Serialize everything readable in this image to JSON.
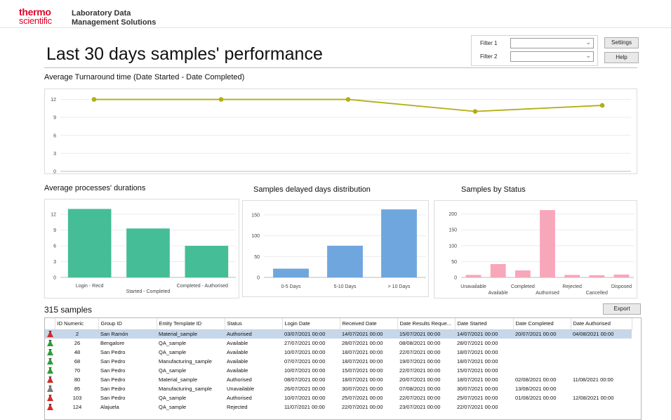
{
  "header": {
    "logo_top": "thermo",
    "logo_bottom": "scientific",
    "app_line1": "Laboratory Data",
    "app_line2": "Management Solutions"
  },
  "page_title": "Last 30 days samples' performance",
  "filters": {
    "filter1_label": "Filter 1",
    "filter2_label": "Filter 2",
    "filter1_value": "",
    "filter2_value": ""
  },
  "buttons": {
    "settings": "Settings",
    "help": "Help",
    "export": "Export"
  },
  "sections": {
    "turnaround": "Average Turnaround time (Date Started - Date Completed)",
    "durations": "Average processes' durations",
    "delayed": "Samples delayed days distribution",
    "status": "Samples by Status"
  },
  "colors": {
    "line": "#b1ae12",
    "green": "#45bd97",
    "blue": "#6fa6dd",
    "pink": "#f8a6ba",
    "selected_row": "#c6d7ea"
  },
  "chart_data": [
    {
      "id": "turnaround",
      "type": "line",
      "title": "Average Turnaround time (Date Started - Date Completed)",
      "x": [
        1,
        2,
        3,
        4,
        5
      ],
      "values": [
        12,
        12,
        12,
        10,
        11
      ],
      "yticks": [
        "0",
        "3",
        "6",
        "9",
        "12"
      ],
      "ylim": [
        0,
        13
      ],
      "grid": true
    },
    {
      "id": "durations",
      "type": "bar",
      "title": "Average processes' durations",
      "categories": [
        "Login - Recd",
        "Started - Completed",
        "Completed - Authorised"
      ],
      "values": [
        13,
        9.3,
        6
      ],
      "yticks": [
        "0",
        "3",
        "6",
        "9",
        "12"
      ],
      "ylim": [
        0,
        14
      ],
      "grid": true
    },
    {
      "id": "delayed",
      "type": "bar",
      "title": "Samples delayed days distribution",
      "categories": [
        "0-5 Days",
        "5-10 Days",
        "> 10 Days"
      ],
      "values": [
        21,
        76,
        163
      ],
      "yticks": [
        "0",
        "50",
        "100",
        "150"
      ],
      "ylim": [
        0,
        175
      ],
      "grid": true
    },
    {
      "id": "status",
      "type": "bar",
      "title": "Samples by Status",
      "categories": [
        "Unavailable",
        "Available",
        "Completed",
        "Authorised",
        "Rejected",
        "Cancelled",
        "Disposed"
      ],
      "values": [
        8,
        42,
        22,
        212,
        8,
        7,
        9
      ],
      "yticks": [
        "0",
        "50",
        "100",
        "150",
        "200"
      ],
      "ylim": [
        0,
        230
      ],
      "grid": true
    }
  ],
  "table": {
    "count_label": "315 samples",
    "columns": [
      "ID Numeric",
      "Group ID",
      "Entity Template ID",
      "Status",
      "Login Date",
      "Received Date",
      "Date Results Reque...",
      "Date Started",
      "Date Completed",
      "Date Authorised"
    ],
    "rows": [
      [
        "2",
        "San Ramón",
        "Material_sample",
        "Authorised",
        "03/07/2021 00:00",
        "14/07/2021 00:00",
        "15/07/2021 00:00",
        "14/07/2021 00:00",
        "20/07/2021 00:00",
        "04/08/2021 00:00"
      ],
      [
        "26",
        "Bengalore",
        "QA_sample",
        "Available",
        "27/07/2021 00:00",
        "28/07/2021 00:00",
        "08/08/2021 00:00",
        "28/07/2021 00:00",
        "",
        ""
      ],
      [
        "48",
        "San Pedro",
        "QA_sample",
        "Available",
        "10/07/2021 00:00",
        "18/07/2021 00:00",
        "22/07/2021 00:00",
        "18/07/2021 00:00",
        "",
        ""
      ],
      [
        "68",
        "San Pedro",
        "Manufacturing_sample",
        "Available",
        "07/07/2021 00:00",
        "18/07/2021 00:00",
        "19/07/2021 00:00",
        "18/07/2021 00:00",
        "",
        ""
      ],
      [
        "70",
        "San Pedro",
        "QA_sample",
        "Available",
        "10/07/2021 00:00",
        "15/07/2021 00:00",
        "22/07/2021 00:00",
        "15/07/2021 00:00",
        "",
        ""
      ],
      [
        "80",
        "San Pedro",
        "Material_sample",
        "Authorised",
        "08/07/2021 00:00",
        "18/07/2021 00:00",
        "20/07/2021 00:00",
        "18/07/2021 00:00",
        "02/08/2021 00:00",
        "11/08/2021 00:00"
      ],
      [
        "85",
        "San Pedro",
        "Manufacturing_sample",
        "Unavailable",
        "26/07/2021 00:00",
        "30/07/2021 00:00",
        "07/08/2021 00:00",
        "30/07/2021 00:00",
        "13/08/2021 00:00",
        ""
      ],
      [
        "103",
        "San Pedro",
        "QA_sample",
        "Authorised",
        "10/07/2021 00:00",
        "25/07/2021 00:00",
        "22/07/2021 00:00",
        "25/07/2021 00:00",
        "01/08/2021 00:00",
        "12/08/2021 00:00"
      ],
      [
        "124",
        "Alajuela",
        "QA_sample",
        "Rejected",
        "11/07/2021 00:00",
        "22/07/2021 00:00",
        "23/07/2021 00:00",
        "22/07/2021 00:00",
        "",
        ""
      ]
    ],
    "row_icons": [
      "flask-red-icon",
      "flask-green-icon",
      "flask-green-icon",
      "flask-green-icon",
      "flask-green-icon",
      "flask-red-icon",
      "flask-grey-icon",
      "flask-red-icon",
      "flask-red-icon"
    ]
  }
}
